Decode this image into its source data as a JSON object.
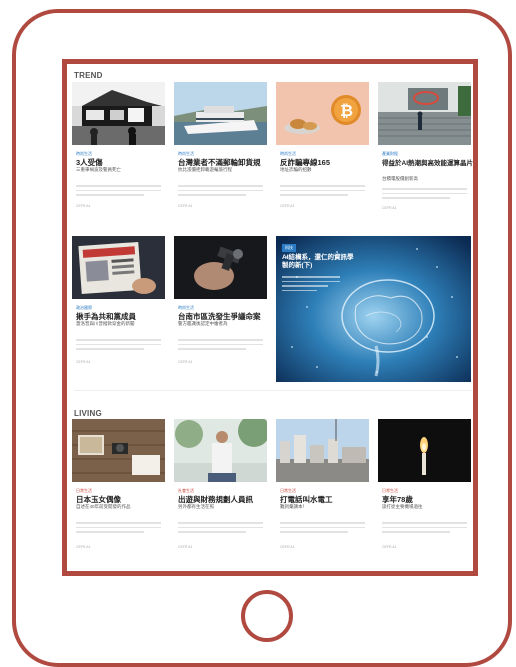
{
  "colors": {
    "frame": "#b04a40",
    "category": "#2a7bc4",
    "accent_more": "#c8453a"
  },
  "trend": {
    "title": "TREND",
    "cards": [
      {
        "category": "時尚生活",
        "title": "3人受傷",
        "subtitle": "三重車禍波及警員死亡",
        "date": "CEFR A1"
      },
      {
        "category": "時尚生活",
        "title": "台灣業者不滿郵輪卸貨規",
        "subtitle": "抗比漲價拒卸載遊輪旅行程",
        "date": "CEFR A1"
      },
      {
        "category": "時尚生活",
        "title": "反詐騙專線165",
        "subtitle": "地址詐騙的招數",
        "date": "CEFR A1"
      },
      {
        "category": "產業財經",
        "title": "得益於AI熱潮與高效能運算晶片需求",
        "subtitle": "台積電股價創新高",
        "date": "CEFR A1"
      },
      {
        "category": "政治國際",
        "title": "揪手為共和黨成員",
        "subtitle": "蓋洛普與川普撥款穿金的新聞",
        "date": "CEFR A1"
      },
      {
        "category": "時尚生活",
        "title": "台南市區洗發生爭議命案",
        "subtitle": "警方鑑識後認定中槍者為",
        "date": "CEFR A1"
      }
    ],
    "featured": {
      "badge": "科技",
      "title": "AI結構系，還仁的資訊學製的新(下)"
    }
  },
  "living": {
    "title": "LIVING",
    "cards": [
      {
        "category": "日常生活",
        "title": "日本玉女偶像",
        "subtitle": "自述在40年前受開發的作品",
        "date": "CEFR A1"
      },
      {
        "category": "社會生活",
        "title": "出遊與財務規劃人員訊",
        "subtitle": "另外都有生活在照",
        "date": "CEFR A1"
      },
      {
        "category": "日常生活",
        "title": "打電話叫水電工",
        "subtitle": "難詞彙講本！",
        "date": "CEFR A1"
      },
      {
        "category": "日常生活",
        "title": "享年78歲",
        "subtitle": "談打從主要機場過往",
        "date": "CEFR A1"
      }
    ]
  }
}
